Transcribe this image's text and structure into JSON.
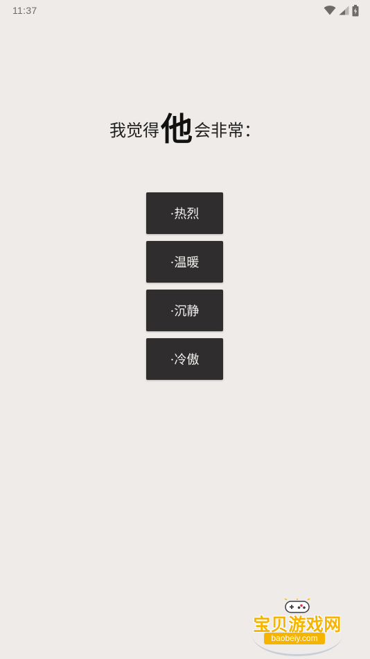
{
  "status_bar": {
    "time": "11:37",
    "icons": [
      "wifi-icon",
      "signal-icon",
      "battery-icon"
    ]
  },
  "question": {
    "prefix": "我觉得",
    "emphasis": "他",
    "suffix": "会非常："
  },
  "options": [
    {
      "label": "·热烈"
    },
    {
      "label": "·温暖"
    },
    {
      "label": "·沉静"
    },
    {
      "label": "·冷傲"
    }
  ],
  "watermark": {
    "brand": "宝贝游戏网",
    "domain": "baobeiy.com",
    "icon": "gamepad-icon"
  },
  "colors": {
    "background": "#efebe8",
    "button": "#2f2d2d",
    "button_text": "#f4f2f0",
    "watermark_accent": "#f5b400"
  }
}
